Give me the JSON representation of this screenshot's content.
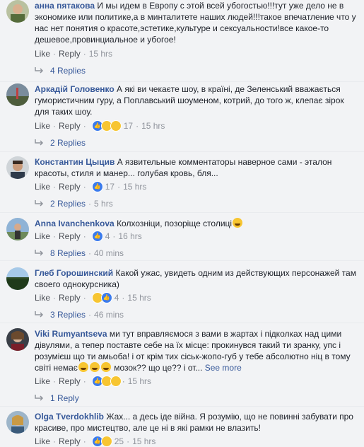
{
  "labels": {
    "like": "Like",
    "reply": "Reply",
    "dot": "·",
    "see_more": "See more"
  },
  "comments": [
    {
      "author": "анна пятакова",
      "text": "И мы идем в Европу с этой всей убогостью!!!тут уже дело не в экономике или политике,а в минталитете наших людей!!!такое впечатление что у нас нет понятия о красоте,эстетике,культуре и сексуальности!все какое-то дешевое,провинциальное и убогое!",
      "time": "15 hrs",
      "reactions": [],
      "reaction_count": "",
      "replies": "4 Replies",
      "replies_time": ""
    },
    {
      "author": "Аркадій Головенко",
      "text": "А які ви чекаєте шоу, в країні, де Зеленський вважається гумористичним гуру, а Поплавський шоуменом, котрий, до того ж, клепає зірок для таких шоу.",
      "time": "15 hrs",
      "reactions": [
        "like",
        "haha",
        "wow"
      ],
      "reaction_count": "17",
      "replies": "2 Replies",
      "replies_time": ""
    },
    {
      "author": "Константин Цыцив",
      "text": "А язвительные комментаторы наверное сами - эталон красоты, стиля и манер... голубая кровь, бля...",
      "time": "15 hrs",
      "reactions": [
        "like"
      ],
      "reaction_count": "17",
      "replies": "2 Replies",
      "replies_time": "5 hrs"
    },
    {
      "author": "Anna Ivanchenkova",
      "text": "Колхозніци, позоріще столиці",
      "time": "16 hrs",
      "reactions": [
        "like"
      ],
      "reaction_count": "4",
      "replies": "8 Replies",
      "replies_time": "40 mins"
    },
    {
      "author": "Глеб Горошинский",
      "text": "Какой ужас, увидеть одним из действующих персонажей там своего однокурсника)",
      "time": "15 hrs",
      "reactions": [
        "haha",
        "like"
      ],
      "reaction_count": "4",
      "replies": "3 Replies",
      "replies_time": "46 mins"
    },
    {
      "author": "Viki Rumyantseva",
      "text": "ми тут вправляємося з вами в жартах і підколках над цими дівулями, а тепер поставте себе на їх місце: прокинувся такий ти зранку, упс і розумієш що ти амьоба! і от крім тих сіськ-жопо-губ у тебе абсолютно ніц в тому світі немає",
      "text_tail": " мозок?? що це?? і от...",
      "time": "15 hrs",
      "reactions": [
        "like",
        "haha",
        "sad"
      ],
      "reaction_count": "",
      "replies": "1 Reply",
      "replies_time": ""
    },
    {
      "author": "Olga Tverdokhlib",
      "text": "Жах... а десь іде війна. Я розумію, що не повинні забувати про красиве, про мистецтво, але це ні в які рамки не влазить!",
      "time": "15 hrs",
      "reactions": [
        "like",
        "haha"
      ],
      "reaction_count": "25",
      "replies": "",
      "replies_time": ""
    }
  ]
}
